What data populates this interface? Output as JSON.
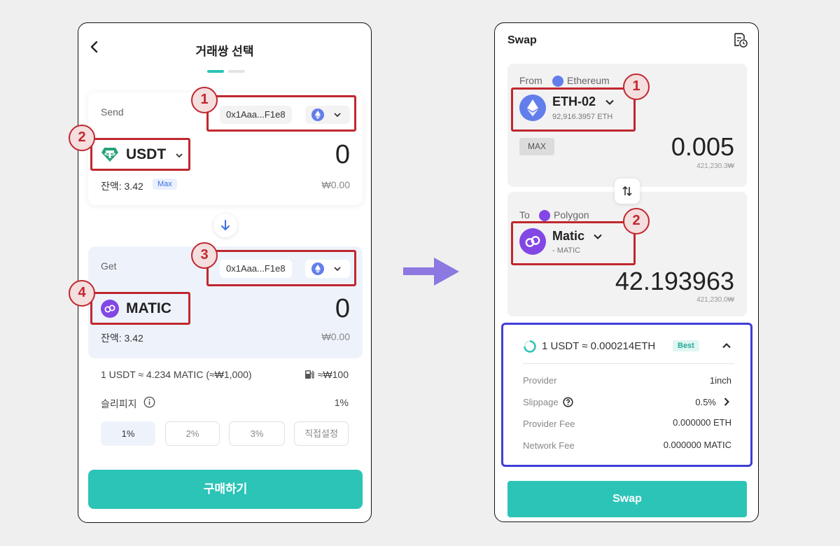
{
  "left": {
    "title": "거래쌍 선택",
    "send": {
      "label": "Send",
      "address": "0x1Aaa...F1e8",
      "token": "USDT",
      "amount": "0",
      "balance": "잔액: 3.42",
      "max": "Max",
      "fiat": "₩0.00"
    },
    "get": {
      "label": "Get",
      "address": "0x1Aaa...F1e8",
      "token": "MATIC",
      "amount": "0",
      "balance": "잔액: 3.42",
      "fiat": "₩0.00"
    },
    "rate": "1 USDT ≈ 4.234 MATIC (≈₩1,000)",
    "gas_fee": "≈₩100",
    "slippage_label": "슬리피지",
    "slippage_value": "1%",
    "slippage_options": [
      "1%",
      "2%",
      "3%",
      "직접설정"
    ],
    "buy_button": "구매하기"
  },
  "right": {
    "title": "Swap",
    "from": {
      "label": "From",
      "chain": "Ethereum",
      "token": "ETH-02",
      "balance": "92,916.3957 ETH",
      "max": "MAX",
      "amount": "0.005",
      "fiat": "421,230.3₩"
    },
    "to": {
      "label": "To",
      "chain": "Polygon",
      "token": "Matic",
      "sub": "- MATIC",
      "amount": "42.193963",
      "fiat": "421,230.0₩"
    },
    "quote": {
      "rate": "1 USDT ≈ 0.000214ETH",
      "badge": "Best",
      "rows": [
        {
          "label": "Provider",
          "value": "1inch"
        },
        {
          "label": "Slippage",
          "value": "0.5%"
        },
        {
          "label": "Provider Fee",
          "value": "0.000000 ETH"
        },
        {
          "label": "Network Fee",
          "value": "0.000000 MATIC"
        }
      ]
    },
    "swap_button": "Swap"
  },
  "annotations": {
    "left_badges": [
      "1",
      "2",
      "3",
      "4"
    ],
    "right_badges": [
      "1",
      "2"
    ]
  },
  "colors": {
    "accent": "#2cc4b6",
    "annotation_red": "#c0282f",
    "annotation_blue": "#3f3fd8",
    "usdt": "#26a17b",
    "eth": "#627eea",
    "matic": "#8247e5",
    "flow_arrow": "#8c78e0"
  },
  "icons": [
    "back-chevron-icon",
    "ethereum-icon",
    "chevron-down-icon",
    "tether-icon",
    "arrow-down-icon",
    "polygon-icon",
    "gas-pump-icon",
    "info-icon",
    "history-icon",
    "swap-direction-icon",
    "loading-ring-icon",
    "chevron-up-icon",
    "help-icon",
    "chevron-right-icon",
    "flow-arrow-icon"
  ]
}
